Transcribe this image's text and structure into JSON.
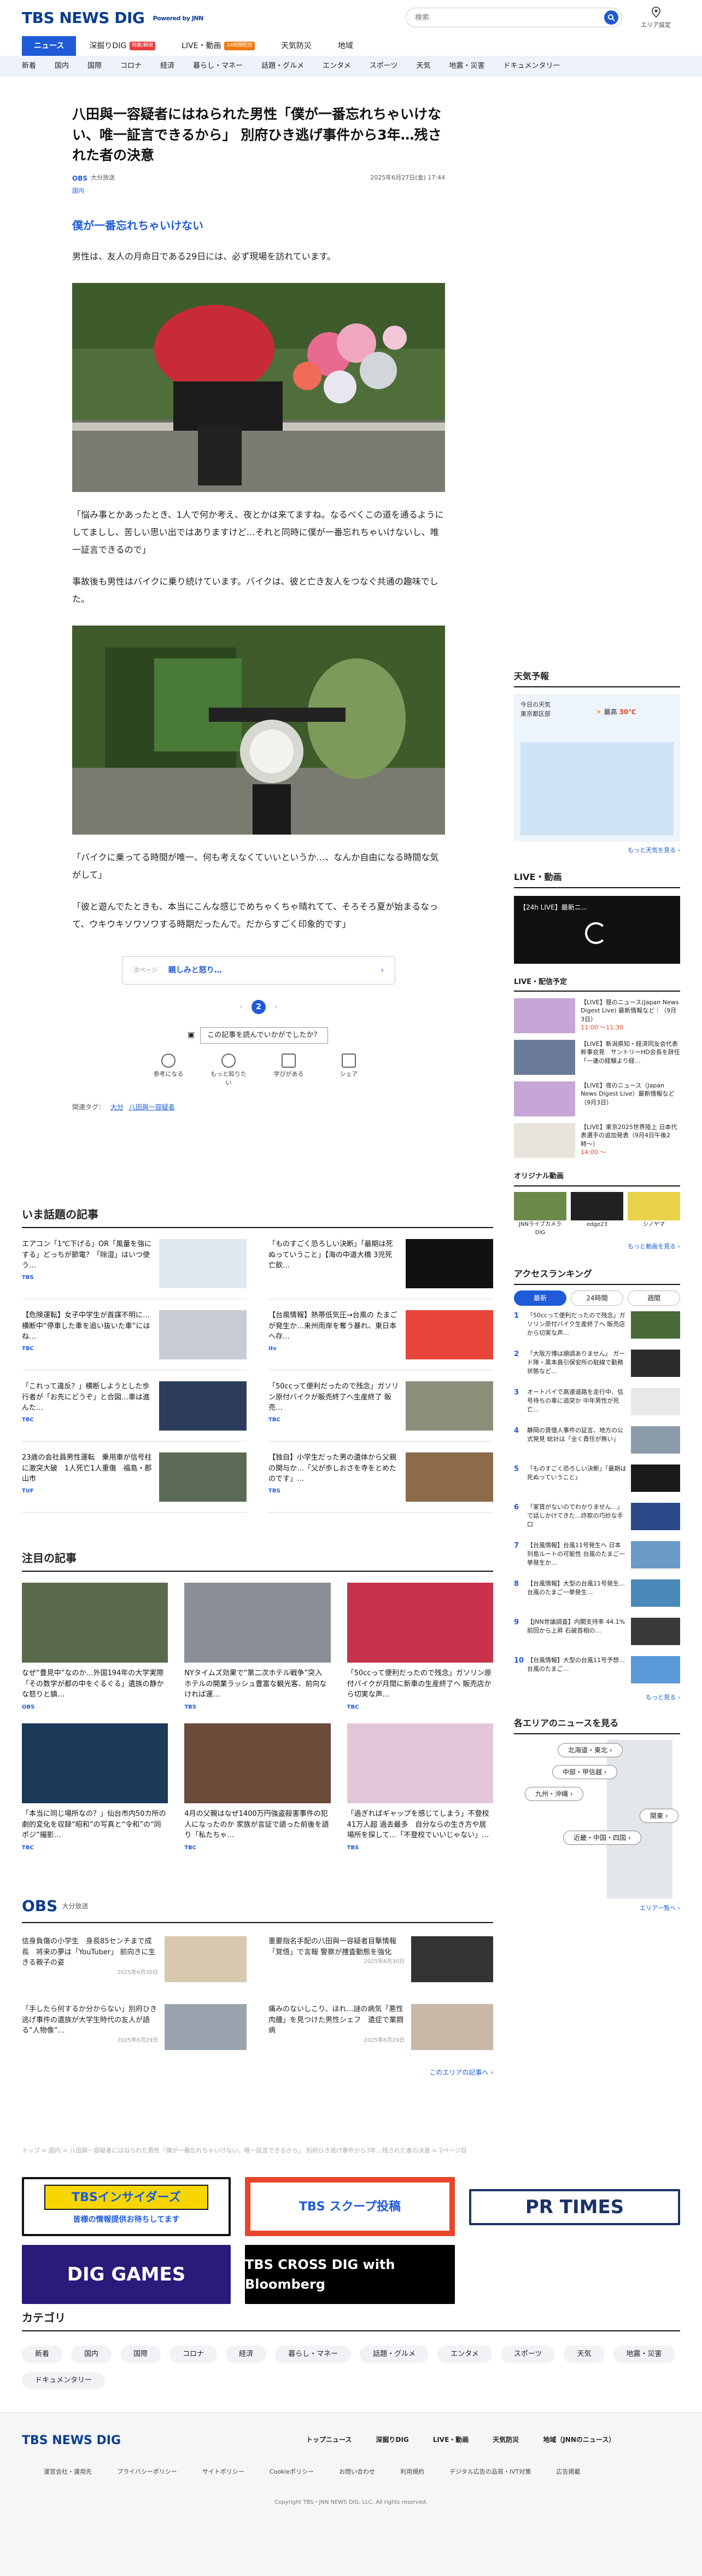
{
  "header": {
    "logo": "TBS NEWS DIG",
    "logo_sub": "Powered by JNN",
    "search_placeholder": "検索",
    "area_setting": "エリア設定"
  },
  "nav_primary": [
    {
      "label": "ニュース",
      "active": true
    },
    {
      "label": "深掘りDIG",
      "badge": "特集/解説",
      "badge_color": "#e83e3e"
    },
    {
      "label": "LIVE・動画",
      "badge": "24時間配信",
      "badge_color": "#f07b12"
    },
    {
      "label": "天気防災"
    },
    {
      "label": "地域"
    }
  ],
  "nav_secondary": [
    "新着",
    "国内",
    "国際",
    "コロナ",
    "経済",
    "暮らし・マネー",
    "話題・グルメ",
    "エンタメ",
    "スポーツ",
    "天気",
    "地震・災害",
    "ドキュメンタリー"
  ],
  "article": {
    "title": "八田與一容疑者にはねられた男性「僕が一番忘れちゃいけない、唯一証言できるから」 別府ひき逃げ事件から3年…残された者の決意",
    "source": "大分放送",
    "source_mark": "OBS",
    "date": "2025年6月27日(金) 17:44",
    "category": "国内",
    "subhead": "僕が一番忘れちゃいけない",
    "p1": "男性は、友人の月命日である29日には、必ず現場を訪れています。",
    "p2": "「悩み事とかあったとき、1人で何か考え、夜とかは来てますね。なるべくこの道を通るようにしてましし、苦しい思い出ではありますけど…それと同時に僕が一番忘れちゃいけないし、唯一証言できるので」",
    "p3": "事故後も男性はバイクに乗り続けています。バイクは、彼と亡き友人をつなぐ共通の趣味でした。",
    "p4": "「バイクに乗ってる時間が唯一、何も考えなくていいというか…、なんか自由になる時間な気がして」",
    "p5": "「彼と遊んでたときも、本当にこんな感じでめちゃくちゃ晴れてて、そろそろ夏が始まるなって、ウキウキソワソワする時期だったんで。だからすごく印象的です」",
    "next_label": "次ページ",
    "next_title": "親しみと怒り…",
    "pages": [
      "‹",
      "2",
      "›"
    ],
    "helpful_q": "この記事を読んでいかがでしたか？",
    "reactions": [
      "参考になる",
      "もっと知りたい",
      "学びがある",
      "シェア"
    ],
    "tags_label": "関連タグ：",
    "tags": [
      "大分",
      "八田與一容疑者"
    ]
  },
  "hot_title": "いま話題の記事",
  "hot": [
    {
      "text": "エアコン「1℃下げる」OR「風量を強にする」どっちが節電？「除湿」はいつ使う…",
      "src": "TBS",
      "date": "2025年7月1日"
    },
    {
      "text": "「ものすごく恐ろしい決断」「最期は死ぬっていうこと」【海の中道大橋 3児死亡飲…",
      "src": "",
      "date": "2025年6月27日"
    },
    {
      "text": "【危険運転】女子中学生が首謀不明に…横断中“停車した車を追い抜いた車”にはね…",
      "src": "TBC",
      "date": "2025年6月26日"
    },
    {
      "text": "【台風情報】熱帯低気圧→台風の たまごが発生か…来州雨岸を奪う暴れ、東日本へ存…",
      "src": "itv",
      "date": "2025年6月30日"
    },
    {
      "text": "「これって違反？」横断しようとした歩行者が「お先にどうぞ」と合図…車は進んた…",
      "src": "TBC",
      "date": "2025年6月27日"
    },
    {
      "text": "「50ccって便利だったので残念」ガソリン原付バイクが販売終了へ生産終了 販売…",
      "src": "TBC",
      "date": "2025年6月30日"
    },
    {
      "text": "23歳の会社員男性運転　乗用車が信号柱に激突大破　1人死亡1人重傷　福島・郡山市",
      "src": "TUF",
      "date": "2025年6月28日"
    },
    {
      "text": "【独自】小学生だった男の遺体から父親の関与か…「父が歩しおさを寺をとめたのです」…",
      "src": "TBS",
      "date": "2025年6月30日"
    }
  ],
  "feat_title": "注目の記事",
  "feat": [
    {
      "text": "なぜ“豊見中”なのか…外国194年の大学実際「その数学が都の中をぐるぐる」遺族の静かな怒りと鎮…",
      "src": "OBS",
      "date": "1日前"
    },
    {
      "text": "NYタイムズ効果で“第二次ホテル戦争”突入　ホテルの開業ラッシュ豊富な観光客、前向なければ運…",
      "src": "TBS",
      "date": "3日前"
    },
    {
      "text": "「50ccって便利だったので残念」ガソリン原付バイクが月間に新車の生産終了へ 販売店から切実な声…",
      "src": "TBC",
      "date": "2日前"
    },
    {
      "text": "「本当に同じ場所なの？」仙台市内50カ所の劇的変化を収録“昭和”の写真と“令和”の“同ポジ”撮影…",
      "src": "TBC",
      "date": "3日前"
    },
    {
      "text": "4月の父親はなぜ1400万円強盗殺害事件の犯人になったのか 家族が言証で語った前後を語り「私たちゃ…",
      "src": "TBC",
      "date": "3日前"
    },
    {
      "text": "「過ぎればギャップを感じてしまう」不登校41万人超 過去最多　自分ならの生き方や居場所を探して…「不登校でいいじゃない」…",
      "src": "TBS",
      "date": "4日前"
    }
  ],
  "obs": {
    "name": "大分放送",
    "items": [
      {
        "text": "信身負傷の小学生　身長85センチまで成長　将来の夢は「YouTuber」 前向きに生きる親子の姿",
        "date": "2025年6月30日"
      },
      {
        "text": "重要指名手配の八田與一容疑者目撃情報「覚悟」で言報 警察が捜査動態を強化",
        "date": "2025年6月30日"
      },
      {
        "text": "「手したら何するか分からない」別府ひき逃げ事件の遺族が大学生時代の友人が語る“人物像”…",
        "date": "2025年6月29日"
      },
      {
        "text": "痛みのないしこり、ほれ…謎の病気「悪性肉腫」を見つけた男性シェフ　遺症で業闘病",
        "date": "2025年6月29日"
      }
    ],
    "more": "このエリアの記事へ ›"
  },
  "breadcrumb": "トップ > 国内 > 八田與一容疑者にはねられた男性「僕が一番忘れちゃいけない、唯一証言できるから」 別府ひき逃げ事件から3年…残された者の決意 > 2ページ目",
  "banners": [
    "TBSインサイダーズ",
    "皆様の情報提供お待ちしてます",
    "TBS スクープ投稿",
    "PR TIMES",
    "DIG GAMES",
    "TBS CROSS DIG with Bloomberg"
  ],
  "categories_title": "カテゴリ",
  "categories": [
    "新着",
    "国内",
    "国際",
    "コロナ",
    "経済",
    "暮らし・マネー",
    "話題・グルメ",
    "エンタメ",
    "スポーツ",
    "天気",
    "地震・災害",
    "ドキュメンタリー"
  ],
  "sidebar": {
    "weather_title": "天気予報",
    "weather_today": "今日の天気",
    "weather_region": "東京都区部",
    "weather_high": "最高",
    "weather_temp": "30℃",
    "weather_more": "もっと天気を見る ›",
    "live_title": "LIVE・動画",
    "live_caption": "【24h LIVE】最新ニ...",
    "sched_title": "LIVE・配信予定",
    "sched": [
      {
        "text": "【LIVE】昼のニュース(Japan News Digest Live) 最新情報など｜（9月3日）",
        "time": "11:00 〜11:30"
      },
      {
        "text": "【LIVE】新潟県知・経済同友会代表幹事会見　サントリーHD会長を辞任「一連の経験より経…",
        "time": ""
      },
      {
        "text": "【LIVE】夜のニュース（Japan News Digest Live）最新情報など（9月3日）",
        "time": ""
      },
      {
        "text": "【LIVE】東京2025世界陸上 日本代表選手の追加発表（9月4日午後2時〜）",
        "time": "14:00 〜"
      }
    ],
    "original_title": "オリジナル動画",
    "original": [
      "JNNライブカメラ DIG",
      "edge23",
      "シノヤマ"
    ],
    "original_more": "もっと動画を見る ›",
    "ranking_title": "アクセスランキング",
    "ranking_tabs": [
      "最新",
      "24時間",
      "週間"
    ],
    "ranking": [
      "「50ccって便利だったので残念」ガソリン原付バイク生産終了へ 販売店から切実な声…",
      "「大阪万博は順調ありません」 ガード隊・黒本員引保安所の駐線で勤務状態など…",
      "オートバイで高速道路を走行中、信号待ちの車に追突か 中年男性が死亡…",
      "静岡の賃借人事件の証言、地方の公式発見 総計は「全く責任が無い」",
      "「ものすごく恐ろしい決断」「最期は死ぬっていうこと」",
      "「家賃がないのでわかりません…」で話しかけてきた…詐欺の巧妙な手口",
      "【台風情報】台風11号発生へ 日本列島ルートの可能性 台風のたまご一挙発生か…",
      "【台風情報】大型の台風11号発生…台風のたまご一挙発生…",
      "【JNN世論調査】内閣支持率 44.1% 前回から上昇 石破首相の…",
      "【台風情報】大型の台風11号予想…台風のたまご…"
    ],
    "ranking_more": "もっと見る ›",
    "area_title": "各エリアのニュースを見る",
    "areas": [
      "北海道・東北 ›",
      "中部・甲信越 ›",
      "九州・沖縄 ›",
      "関東 ›",
      "近畿・中国・四国 ›"
    ],
    "area_more": "エリア一覧へ ›"
  },
  "footer": {
    "logo": "TBS NEWS DIG",
    "nav": [
      "トップニュース",
      "深掘りDIG",
      "LIVE・動画",
      "天気防災",
      "地域（JNNのニュース）"
    ],
    "sub": [
      "運営会社・運用先",
      "プライバシーポリシー",
      "サイトポリシー",
      "Cookieポリシー",
      "お問い合わせ",
      "利用規約",
      "デジタル広告の品質・IVT対策",
      "広告掲載"
    ],
    "copyright": "Copyright TBS・JNN NEWS DIG, LLC. All rights reserved."
  }
}
